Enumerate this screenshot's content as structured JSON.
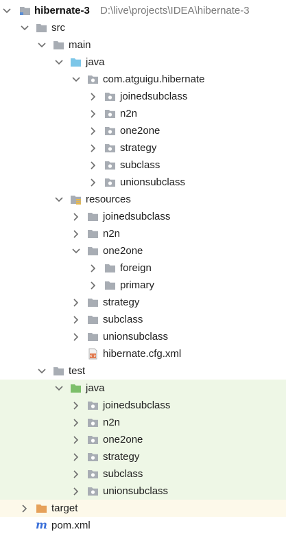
{
  "project": {
    "name": "hibernate-3",
    "path": "D:\\live\\projects\\IDEA\\hibernate-3"
  },
  "tree": {
    "src": "src",
    "main": "main",
    "main_java": "java",
    "package": "com.atguigu.hibernate",
    "pkg_items": [
      "joinedsubclass",
      "n2n",
      "one2one",
      "strategy",
      "subclass",
      "unionsubclass"
    ],
    "resources": "resources",
    "res_items_a": [
      "joinedsubclass",
      "n2n",
      "one2one"
    ],
    "res_one2one_children": [
      "foreign",
      "primary"
    ],
    "res_items_b": [
      "strategy",
      "subclass",
      "unionsubclass"
    ],
    "config_file": "hibernate.cfg.xml",
    "test": "test",
    "test_java": "java",
    "test_items": [
      "joinedsubclass",
      "n2n",
      "one2one",
      "strategy",
      "subclass",
      "unionsubclass"
    ],
    "target": "target",
    "pom": "pom.xml"
  },
  "colors": {
    "folder": "#a8adb4",
    "folder_source": "#7cc6e8",
    "folder_test": "#7cbf6a",
    "folder_excluded": "#e6a15a",
    "test_row_bg": "#eef7e6",
    "target_row_bg": "#fdf9ea",
    "maven": "#3a6fd8"
  }
}
